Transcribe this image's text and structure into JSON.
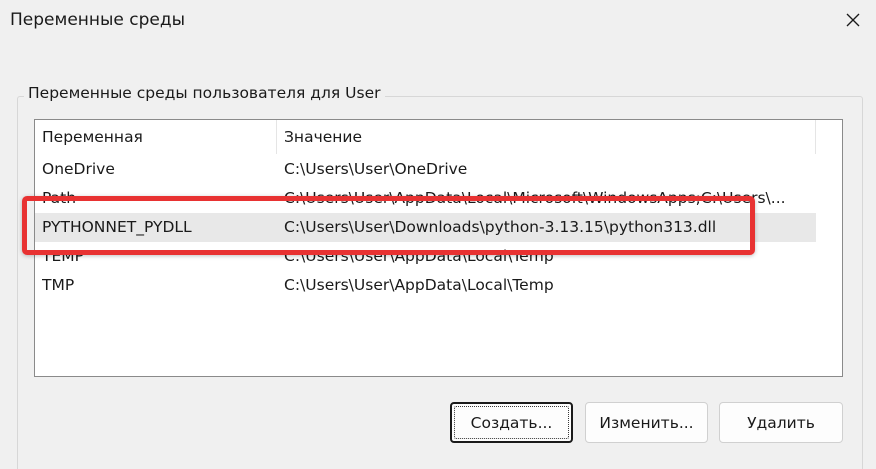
{
  "window": {
    "title": "Переменные среды"
  },
  "user_vars": {
    "group_label": "Переменные среды пользователя для User",
    "columns": {
      "variable": "Переменная",
      "value": "Значение"
    },
    "rows": [
      {
        "variable": "OneDrive",
        "value": "C:\\Users\\User\\OneDrive"
      },
      {
        "variable": "Path",
        "value": "C:\\Users\\User\\AppData\\Local\\Microsoft\\WindowsApps;C:\\Users\\..."
      },
      {
        "variable": "PYTHONNET_PYDLL",
        "value": "C:\\Users\\User\\Downloads\\python-3.13.15\\python313.dll"
      },
      {
        "variable": "TEMP",
        "value": "C:\\Users\\User\\AppData\\Local\\Temp"
      },
      {
        "variable": "TMP",
        "value": "C:\\Users\\User\\AppData\\Local\\Temp"
      }
    ],
    "selected_index": 2
  },
  "buttons": {
    "create": "Создать...",
    "edit": "Изменить...",
    "delete": "Удалить"
  },
  "colors": {
    "highlight": "#e83232",
    "background": "#f0f0f0"
  }
}
